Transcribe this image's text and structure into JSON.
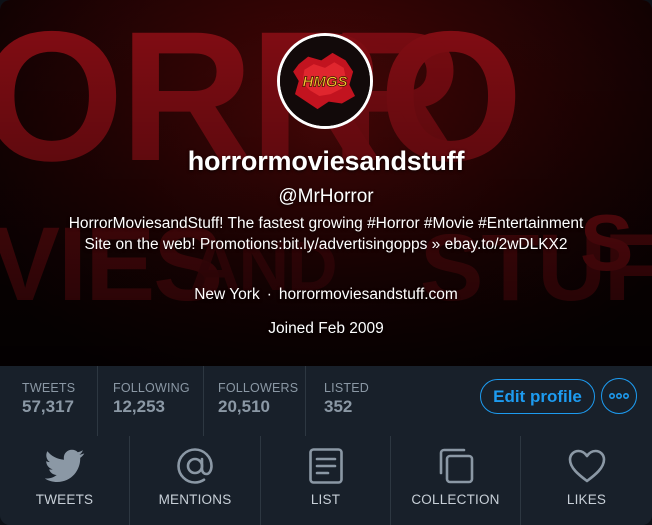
{
  "profile": {
    "avatar_text": "HMGS",
    "display_name": "horrormoviesandstuff",
    "handle": "@MrHorror",
    "bio": "HorrorMoviesandStuff! The fastest growing #Horror #Movie #Entertainment Site on the web! Promotions:bit.ly/advertisingopps » ebay.to/2wDLKX2",
    "location": "New York",
    "separator": "·",
    "website": "horrormoviesandstuff.com",
    "joined": "Joined Feb 2009",
    "banner_text": "HORROR MOVIES AND STUFF"
  },
  "stats": {
    "tweets": {
      "label": "TWEETS",
      "value": "57,317"
    },
    "following": {
      "label": "FOLLOWING",
      "value": "12,253"
    },
    "followers": {
      "label": "FOLLOWERS",
      "value": "20,510"
    },
    "listed": {
      "label": "LISTED",
      "value": "352"
    }
  },
  "actions": {
    "edit_profile": "Edit profile",
    "more_icon": "more-dots-icon"
  },
  "tabs": [
    {
      "label": "TWEETS",
      "icon": "twitter-bird-icon"
    },
    {
      "label": "MENTIONS",
      "icon": "at-sign-icon"
    },
    {
      "label": "LIST",
      "icon": "list-document-icon"
    },
    {
      "label": "COLLECTION",
      "icon": "collection-stack-icon"
    },
    {
      "label": "LIKES",
      "icon": "heart-icon"
    }
  ],
  "colors": {
    "accent": "#1d9bf0",
    "background": "#15202b",
    "banner_red": "#b5121b"
  }
}
